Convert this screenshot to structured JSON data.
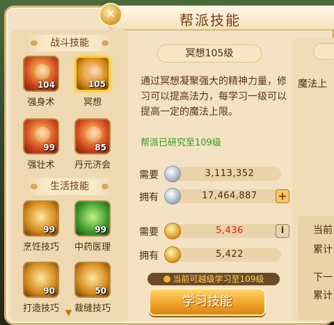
{
  "window": {
    "title": "帮派技能",
    "close_icon": "close-icon"
  },
  "left": {
    "combat_header": "战斗技能",
    "life_header": "生活技能",
    "skills": [
      {
        "name": "强身术",
        "level": "104",
        "selected": false
      },
      {
        "name": "冥想",
        "level": "105",
        "selected": true
      },
      {
        "name": "强壮术",
        "level": "99",
        "selected": false
      },
      {
        "name": "丹元济会",
        "level": "85",
        "selected": false
      },
      {
        "name": "烹饪技巧",
        "level": "99",
        "selected": false
      },
      {
        "name": "中药医理",
        "level": "99",
        "selected": false
      },
      {
        "name": "打造技巧",
        "level": "90",
        "selected": false
      },
      {
        "name": "裁缝技巧",
        "level": "50",
        "selected": false
      }
    ]
  },
  "detail": {
    "skill_name": "冥想105级",
    "description": "通过冥想凝聚强大的精神力量，修习可以提高法力，每学习一级可以提高一定的魔法上限。",
    "researched": "帮派已研究至109级",
    "silver_need_label": "需要",
    "silver_need_value": "3,113,352",
    "silver_have_label": "拥有",
    "silver_have_value": "17,464,887",
    "contrib_need_label": "需要",
    "contrib_need_value": "5,436",
    "contrib_have_label": "拥有",
    "contrib_have_value": "5,422",
    "notice": "当前可越级学习至109级",
    "learn_button": "学习技能"
  },
  "right": {
    "text1": "魔法上",
    "text2": "当前",
    "text3": "累计",
    "text4": "下一",
    "text5": "累计"
  }
}
